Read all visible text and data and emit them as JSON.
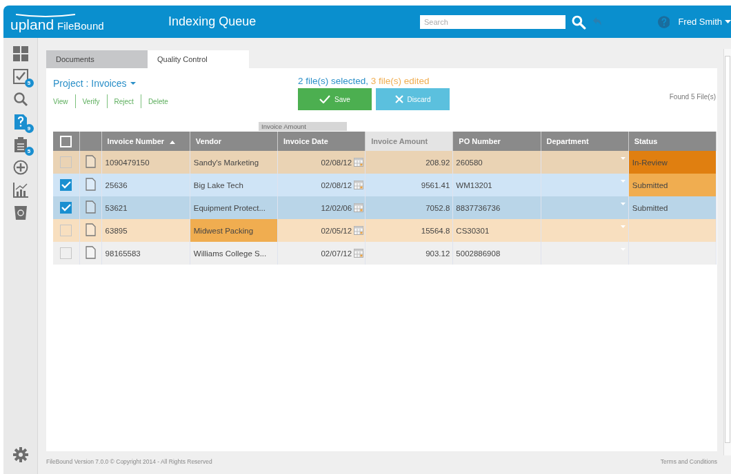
{
  "header": {
    "brand": "upland",
    "product": "FileBound",
    "title": "Indexing Queue",
    "search": {
      "placeholder": "Search"
    },
    "user": "Fred Smith"
  },
  "sidebar": {
    "items": [
      {
        "kind": "grid",
        "selected": false
      },
      {
        "kind": "check",
        "badge": "5",
        "selected": false
      },
      {
        "kind": "search",
        "selected": false
      },
      {
        "kind": "question",
        "badge": "9",
        "selected": true
      },
      {
        "kind": "clipboard",
        "badge": "5",
        "selected": false
      },
      {
        "kind": "plus",
        "selected": false
      },
      {
        "kind": "chart",
        "selected": false
      },
      {
        "kind": "bin",
        "selected": false
      }
    ],
    "footer_item": {
      "kind": "gear"
    }
  },
  "tabs": [
    {
      "label": "Documents",
      "selected": false
    },
    {
      "label": "Quality Control",
      "selected": true
    }
  ],
  "project": "Project : Invoices",
  "actions": [
    "View",
    "Verify",
    "Reject",
    "Delete"
  ],
  "selection": {
    "selected": "2 file(s) selected,",
    "edited": "3 file(s) edited"
  },
  "buttons": [
    {
      "kind": "save",
      "label": "Save"
    },
    {
      "kind": "discard",
      "label": "Discard"
    }
  ],
  "found": "Found 5 File(s)",
  "table": {
    "columns": [
      {
        "kind": "check",
        "checked": false
      },
      {
        "kind": "icon"
      },
      {
        "kind": "text",
        "label": "Invoice Number",
        "sorted": true
      },
      {
        "kind": "text",
        "label": "Vendor"
      },
      {
        "kind": "text",
        "label": "Invoice Date"
      },
      {
        "kind": "text",
        "label": "Invoice Amount",
        "dragging": true
      },
      {
        "kind": "text",
        "label": "PO Number"
      },
      {
        "kind": "text",
        "label": "Department"
      },
      {
        "kind": "text",
        "label": "Status"
      }
    ],
    "drag_label": "Invoice Amount",
    "rows": [
      {
        "color": "#ead3b4",
        "checked": false,
        "number": "1090479150",
        "vendor": {
          "text": "Sandy's Marketing"
        },
        "date": "02/08/12",
        "amount": "208.92",
        "po": "260580",
        "status": {
          "text": "In-Review",
          "color": "#e07f10"
        }
      },
      {
        "color": "#cfe4f6",
        "checked": true,
        "number": "25636",
        "vendor": {
          "text": "Big Lake Tech"
        },
        "date": "02/08/12",
        "amount": "9561.41",
        "po": "WM13201",
        "status": {
          "text": "Submitted",
          "color": "#f0ad50"
        }
      },
      {
        "color": "#b9d5e8",
        "checked": true,
        "number": "53621",
        "vendor": {
          "text": "Equipment Protect..."
        },
        "date": "12/02/06",
        "amount": "7052.8",
        "po": "8837736736",
        "status": {
          "text": "Submitted"
        }
      },
      {
        "color": "#f8dfbf",
        "checked": false,
        "number": "63895",
        "vendor": {
          "text": "Midwest Packing",
          "color": "#f0ad50"
        },
        "date": "02/05/12",
        "amount": "15564.8",
        "po": "CS30301"
      },
      {
        "color": "#efefef",
        "checked": false,
        "number": "98165583",
        "vendor": {
          "text": "Williams College S..."
        },
        "date": "02/07/12",
        "amount": "903.12",
        "po": "5002886908"
      }
    ]
  },
  "footer": {
    "copyright": "FileBound Version 7.0.0 © Copyright 2014 - All Rights Reserved",
    "link": "Terms and Conditions"
  }
}
